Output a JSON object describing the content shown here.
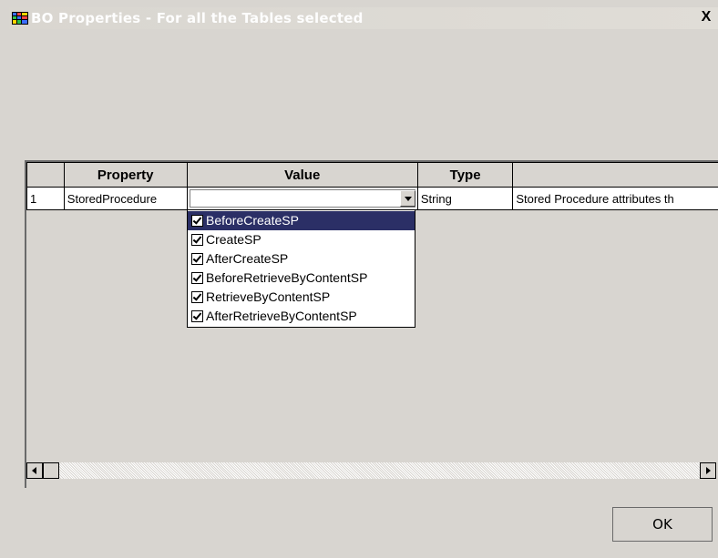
{
  "window": {
    "title": "BO Properties - For all the Tables selected",
    "close_symbol": "X",
    "icon": "table-icon"
  },
  "grid": {
    "columns": [
      "",
      "Property",
      "Value",
      "Type",
      ""
    ],
    "rows": [
      {
        "row_number": "1",
        "property": "StoredProcedure",
        "value": "",
        "type": "String",
        "description": "Stored Procedure attributes th"
      }
    ]
  },
  "dropdown": {
    "items": [
      {
        "label": "BeforeCreateSP",
        "checked": true,
        "selected": true
      },
      {
        "label": "CreateSP",
        "checked": true,
        "selected": false
      },
      {
        "label": "AfterCreateSP",
        "checked": true,
        "selected": false
      },
      {
        "label": "BeforeRetrieveByContentSP",
        "checked": true,
        "selected": false
      },
      {
        "label": "RetrieveByContentSP",
        "checked": true,
        "selected": false
      },
      {
        "label": "AfterRetrieveByContentSP",
        "checked": true,
        "selected": false
      }
    ]
  },
  "buttons": {
    "ok": "OK"
  },
  "colors": {
    "selection": "#2b2f66",
    "window_bg": "#d8d5d0"
  }
}
